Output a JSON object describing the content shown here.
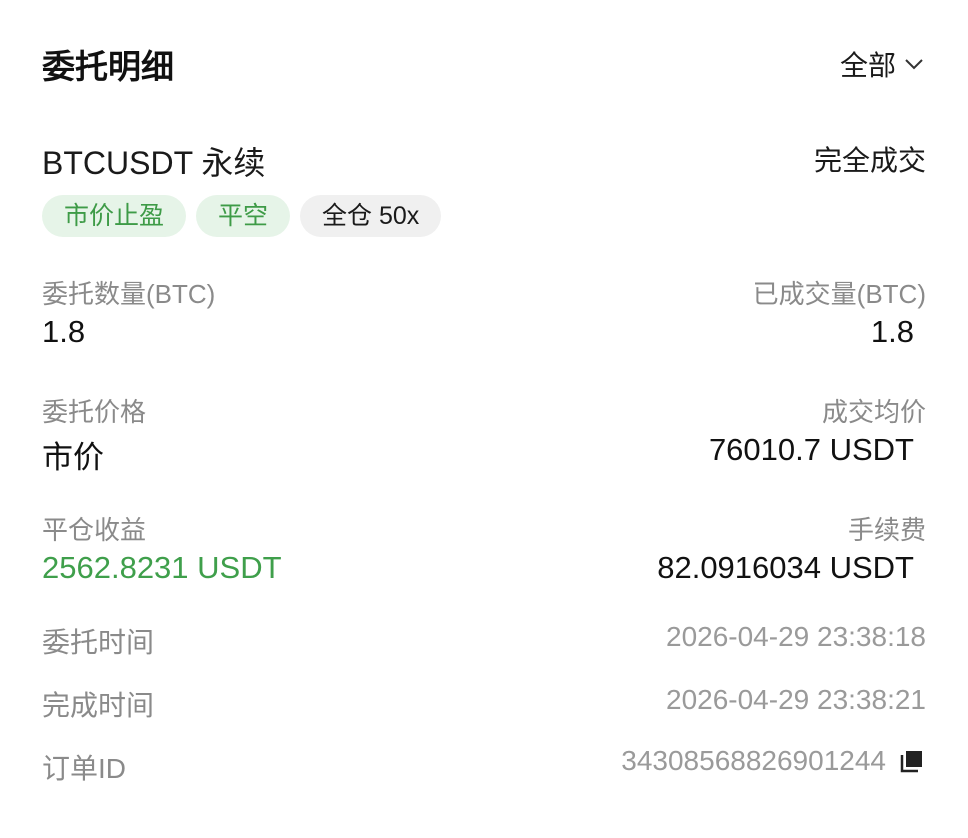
{
  "header": {
    "title": "委托明细",
    "filter_label": "全部"
  },
  "order": {
    "symbol": "BTCUSDT 永续",
    "status": "完全成交",
    "tags": [
      "市价止盈",
      "平空",
      "全仓 50x"
    ],
    "fields": {
      "order_qty_label": "委托数量(BTC)",
      "order_qty_value": "1.8",
      "filled_qty_label": "已成交量(BTC)",
      "filled_qty_value": "1.8",
      "order_price_label": "委托价格",
      "order_price_value": "市价",
      "avg_price_label": "成交均价",
      "avg_price_value": "76010.7 USDT",
      "pnl_label": "平仓收益",
      "pnl_value": "2562.8231 USDT",
      "fee_label": "手续费",
      "fee_value": "82.0916034 USDT"
    },
    "meta": {
      "order_time_label": "委托时间",
      "order_time_value": "2026-04-29 23:38:18",
      "complete_time_label": "完成时间",
      "complete_time_value": "2026-04-29 23:38:21",
      "order_id_label": "订单ID",
      "order_id_value": "3430856882690124​4"
    }
  },
  "colors": {
    "profit_green": "#3f9f4b",
    "tag_green_bg": "#e6f4e8",
    "tag_grey_bg": "#f0f0f0",
    "label_grey": "#8a8a8a"
  },
  "icons": {
    "filter": "chevron-down-icon",
    "copy": "copy-icon"
  }
}
